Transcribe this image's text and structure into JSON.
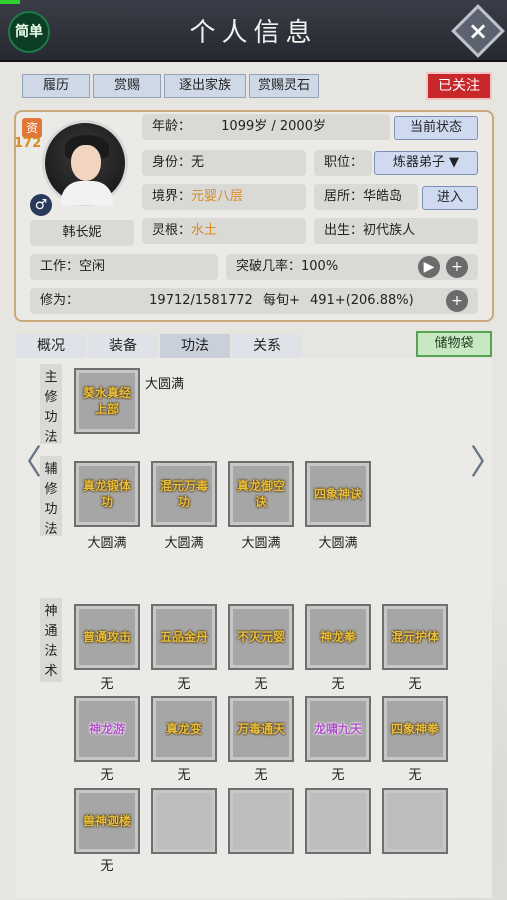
{
  "header": {
    "title": "个人信息",
    "simple_label": "简单",
    "close_icon": "×"
  },
  "top_tabs": [
    "履历",
    "赏赐",
    "逐出家族",
    "赏赐灵石"
  ],
  "follow_label": "已关注",
  "profile": {
    "zi_label": "资",
    "zi_value": "172",
    "name": "韩长妮",
    "gender_icon": "♂",
    "age_label": "年龄：",
    "age_value": "1099岁 / 2000岁",
    "status_button": "当前状态",
    "identity_label": "身份：",
    "identity_value": "无",
    "position_label": "职位：",
    "position_value": "炼器弟子 ▼",
    "realm_label": "境界：",
    "realm_value": "元婴八层",
    "residence_label": "居所：",
    "residence_value": "华皓岛",
    "enter_button": "进入",
    "root_label": "灵根：",
    "root_value": "水土",
    "birth_label": "出生：",
    "birth_value": "初代族人",
    "work_label": "工作：",
    "work_value": "空闲",
    "breakthrough_label": "突破几率：",
    "breakthrough_value": "100%",
    "cultivation_label": "修为：",
    "cultivation_value": "19712/1581772",
    "per_turn_label": "每旬+",
    "per_turn_value": "491+(206.88%)"
  },
  "sub_tabs": [
    "概况",
    "装备",
    "功法",
    "关系"
  ],
  "bag_label": "储物袋",
  "sections": {
    "main": {
      "label": "主修功法",
      "skills": [
        {
          "name": "葵水真经上部",
          "level": "大圆满"
        }
      ]
    },
    "aux": {
      "label": "辅修功法",
      "skills": [
        {
          "name": "真龙锻体功",
          "level": "大圆满"
        },
        {
          "name": "混元万毒功",
          "level": "大圆满"
        },
        {
          "name": "真龙御空诀",
          "level": "大圆满"
        },
        {
          "name": "四象神诀",
          "level": "大圆满"
        }
      ]
    },
    "magic": {
      "label": "神通法术",
      "skills": [
        {
          "name": "普通攻击",
          "level": "无"
        },
        {
          "name": "五品金丹",
          "level": "无"
        },
        {
          "name": "不灭元婴",
          "level": "无"
        },
        {
          "name": "神龙拳",
          "level": "无"
        },
        {
          "name": "混元护体",
          "level": "无"
        },
        {
          "name": "神龙游",
          "level": "无"
        },
        {
          "name": "真龙变",
          "level": "无"
        },
        {
          "name": "万毒通天",
          "level": "无"
        },
        {
          "name": "龙啸九天",
          "level": "无"
        },
        {
          "name": "四象神拳",
          "level": "无"
        },
        {
          "name": "兽神迦楼",
          "level": "无"
        }
      ]
    }
  },
  "arrows": {
    "left": "〈",
    "right": "〉"
  }
}
